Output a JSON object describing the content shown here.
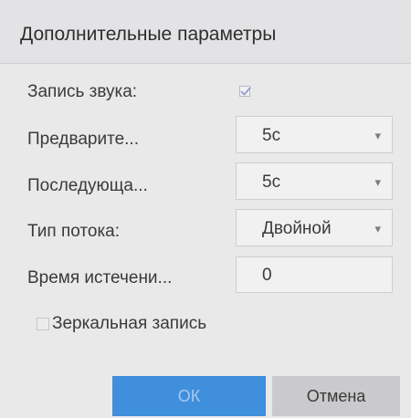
{
  "dialog": {
    "title": "Дополнительные параметры"
  },
  "fields": {
    "audio": {
      "label": "Запись звука:",
      "checked": true
    },
    "pre_record": {
      "label": "Предварите...",
      "value": "5с"
    },
    "post_record": {
      "label": "Последующа...",
      "value": "5с"
    },
    "stream_type": {
      "label": "Тип потока:",
      "value": "Двойной"
    },
    "expiry": {
      "label": "Время истечени...",
      "value": "0"
    },
    "mirror": {
      "label": "Зеркальная запись",
      "checked": false
    }
  },
  "buttons": {
    "ok": "ОК",
    "cancel": "Отмена"
  },
  "icons": {
    "checkmark": "checkmark-icon",
    "dropdown": "chevron-down-icon"
  },
  "colors": {
    "accent": "#3f8fdc",
    "background": "#e9e9ea",
    "cancel_bg": "#cacacd"
  }
}
